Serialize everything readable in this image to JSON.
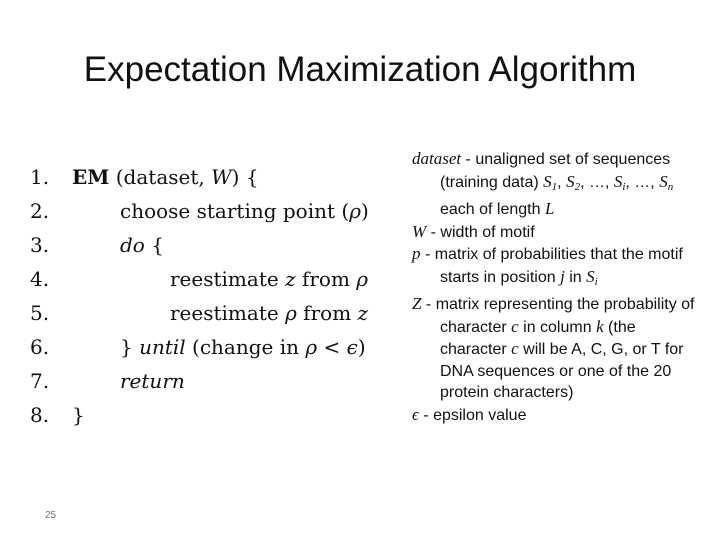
{
  "slide": {
    "title": "Expectation Maximization Algorithm",
    "page_number": "25"
  },
  "algorithm": {
    "lines": [
      {
        "num": "1.",
        "parts": [
          {
            "text": "EM",
            "style": "bold"
          },
          {
            "text": " (dataset, ",
            "style": "normal"
          },
          {
            "text": "W",
            "style": "italic"
          },
          {
            "text": ") {",
            "style": "normal"
          }
        ]
      },
      {
        "num": "2.",
        "parts": [
          {
            "text": "choose starting point (",
            "style": "normal"
          },
          {
            "text": "ρ",
            "style": "italic"
          },
          {
            "text": ")",
            "style": "normal"
          }
        ]
      },
      {
        "num": "3.",
        "parts": [
          {
            "text": "do",
            "style": "italic"
          },
          {
            "text": " {",
            "style": "normal"
          }
        ]
      },
      {
        "num": "4.",
        "parts": [
          {
            "text": "reestimate ",
            "style": "normal"
          },
          {
            "text": "z",
            "style": "italic"
          },
          {
            "text": " from ",
            "style": "normal"
          },
          {
            "text": "ρ",
            "style": "italic"
          }
        ]
      },
      {
        "num": "5.",
        "parts": [
          {
            "text": "reestimate ",
            "style": "normal"
          },
          {
            "text": "ρ",
            "style": "italic"
          },
          {
            "text": " from ",
            "style": "normal"
          },
          {
            "text": "z",
            "style": "italic"
          }
        ]
      },
      {
        "num": "6.",
        "parts": [
          {
            "text": "} ",
            "style": "normal"
          },
          {
            "text": "until",
            "style": "italic"
          },
          {
            "text": " (change in ",
            "style": "normal"
          },
          {
            "text": "ρ",
            "style": "italic"
          },
          {
            "text": " < ",
            "style": "normal"
          },
          {
            "text": "ϵ",
            "style": "italic"
          },
          {
            "text": ")",
            "style": "normal"
          }
        ]
      },
      {
        "num": "7.",
        "parts": [
          {
            "text": "return",
            "style": "italic"
          }
        ]
      },
      {
        "num": "8.",
        "parts": [
          {
            "text": "}",
            "style": "normal"
          }
        ]
      }
    ]
  },
  "definitions": [
    {
      "symbol": "dataset",
      "parts": [
        {
          "text": " - unaligned set of sequences (training data) ",
          "style": "normal"
        },
        {
          "text": "S",
          "style": "sym"
        },
        {
          "text": "1",
          "style": "sub"
        },
        {
          "text": ", ",
          "style": "normal"
        },
        {
          "text": "S",
          "style": "sym"
        },
        {
          "text": "2",
          "style": "sub"
        },
        {
          "text": ", …, ",
          "style": "normal"
        },
        {
          "text": "S",
          "style": "sym"
        },
        {
          "text": "i",
          "style": "sub"
        },
        {
          "text": ", …, ",
          "style": "normal"
        },
        {
          "text": "S",
          "style": "sym"
        },
        {
          "text": "n",
          "style": "sub"
        },
        {
          "text": "  each of length ",
          "style": "normal"
        },
        {
          "text": "L",
          "style": "sym"
        }
      ]
    },
    {
      "symbol": "W",
      "parts": [
        {
          "text": " - width of motif",
          "style": "normal"
        }
      ]
    },
    {
      "symbol": "p",
      "parts": [
        {
          "text": " - matrix of probabilities that the motif starts in position ",
          "style": "normal"
        },
        {
          "text": "j",
          "style": "sym"
        },
        {
          "text": " in ",
          "style": "normal"
        },
        {
          "text": "S",
          "style": "sym"
        },
        {
          "text": "i",
          "style": "sub"
        }
      ]
    },
    {
      "symbol": "Z",
      "parts": [
        {
          "text": " - matrix representing the probability of character ",
          "style": "normal"
        },
        {
          "text": "c",
          "style": "sym"
        },
        {
          "text": " in column ",
          "style": "normal"
        },
        {
          "text": "k",
          "style": "sym"
        },
        {
          "text": " (the character ",
          "style": "normal"
        },
        {
          "text": "c",
          "style": "sym"
        },
        {
          "text": " will be A, C, G, or T for DNA sequences or one of the 20 protein characters)",
          "style": "normal"
        }
      ]
    },
    {
      "symbol": "ϵ",
      "parts": [
        {
          "text": " - epsilon value",
          "style": "normal"
        }
      ]
    }
  ]
}
